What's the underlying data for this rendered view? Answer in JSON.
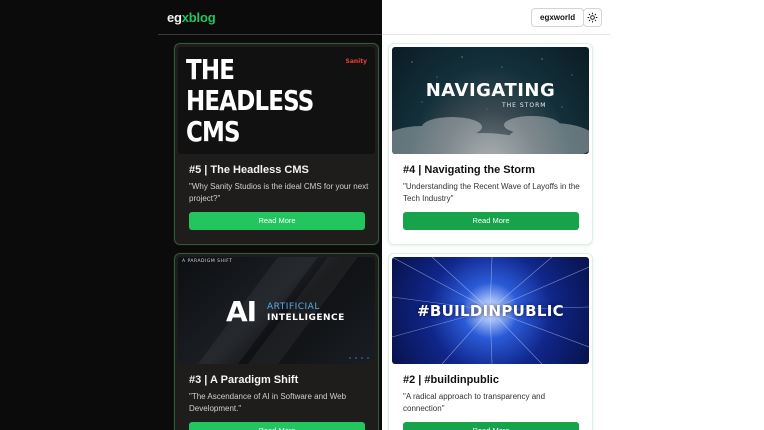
{
  "header": {
    "logo_part1": "eg",
    "logo_part2": "xblog",
    "profile_label": "egxworld",
    "theme_icon": "sun-icon"
  },
  "posts": [
    {
      "title": "#5 | The Headless CMS",
      "description": "\"Why Sanity Studios is the ideal CMS for your next project?\"",
      "button": "Read More",
      "image_text_lines": [
        "THE",
        "HEADLESS",
        "CMS"
      ],
      "image_badge": "Sanity"
    },
    {
      "title": "#4 | Navigating the Storm",
      "description": "\"Understanding the Recent Wave of Layoffs in the Tech Industry\"",
      "button": "Read More",
      "image_text_main": "NAVIGATING",
      "image_text_sub": "THE STORM"
    },
    {
      "title": "#3 | A Paradigm Shift",
      "description": "\"The Ascendance of AI in Software and Web Development.\"",
      "button": "Read More",
      "image_top_label": "A PARADIGM SHIFT",
      "image_ai": "AI",
      "image_line1": "ARTIFICIAL",
      "image_line2": "INTELLIGENCE"
    },
    {
      "title": "#2 | #buildinpublic",
      "description": "\"A radical approach to transparency and connection\"",
      "button": "Read More",
      "image_text_main": "#BUILDINPUBLIC"
    }
  ],
  "colors": {
    "accent_green": "#22c55e",
    "dark_bg": "#0b0b0b",
    "light_bg": "#ffffff"
  }
}
